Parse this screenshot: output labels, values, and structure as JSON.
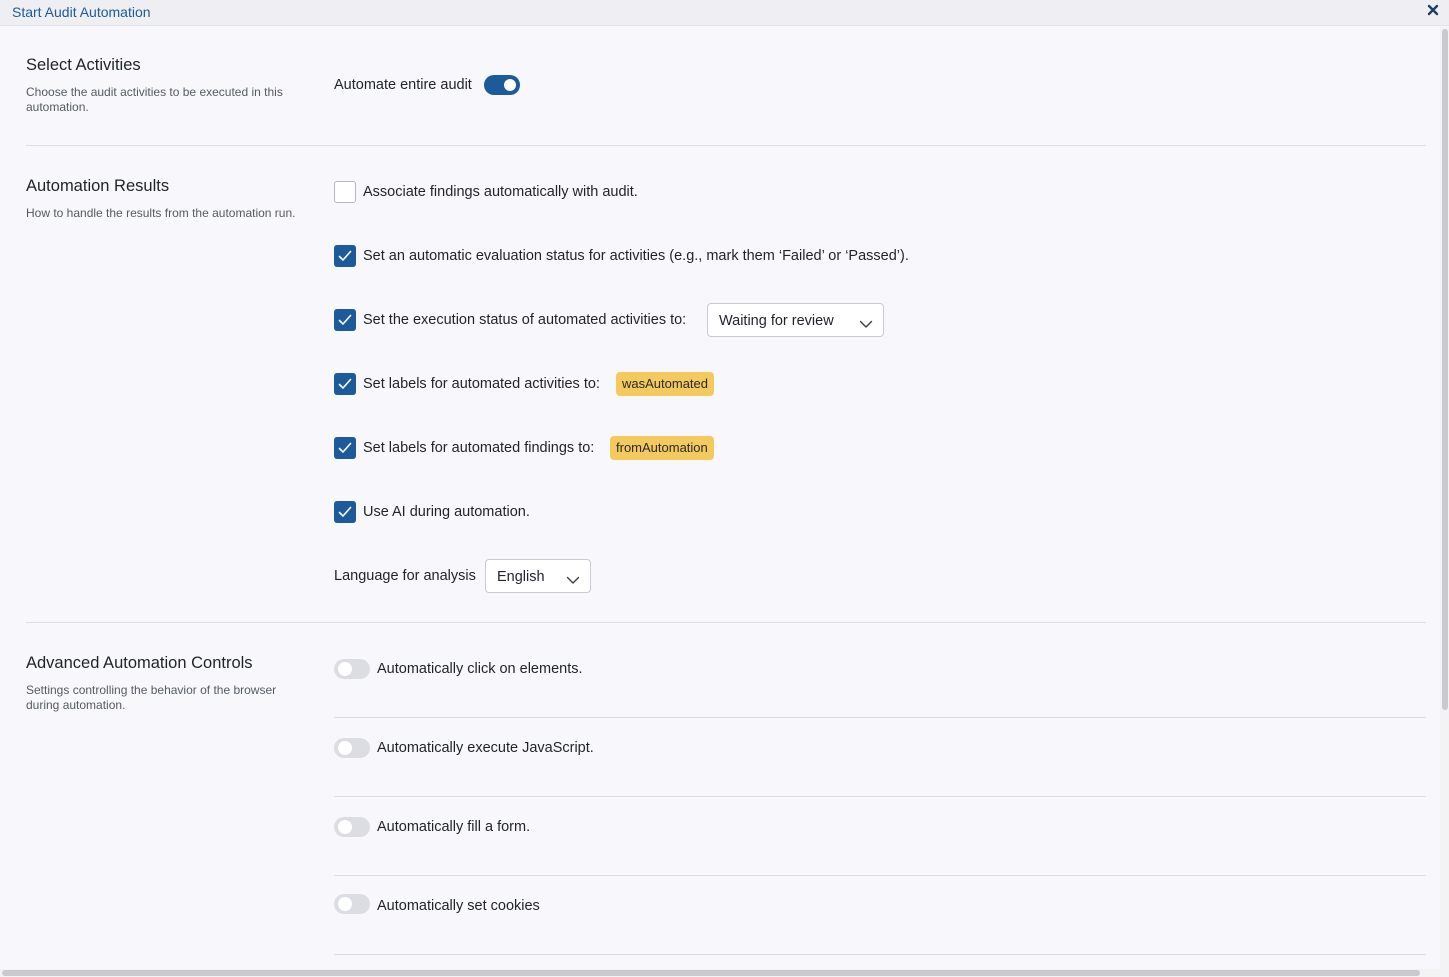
{
  "window": {
    "title": "Start Audit Automation"
  },
  "sections": {
    "select_activities": {
      "title": "Select Activities",
      "description": "Choose the audit activities to be executed in this automation.",
      "toggle_label": "Automate entire audit",
      "toggle_on": true
    },
    "automation_results": {
      "title": "Automation Results",
      "description": "How to handle the results from the automation run.",
      "associate_findings": {
        "label": "Associate findings automatically with audit.",
        "checked": false
      },
      "evaluation_status": {
        "label": "Set an automatic evaluation status for activities (e.g., mark them ‘Failed’ or ‘Passed’).",
        "checked": true
      },
      "execution_status": {
        "label": "Set the execution status of automated activities to:",
        "checked": true,
        "selected": "Waiting for review"
      },
      "activity_labels": {
        "label": "Set labels for automated activities to:",
        "checked": true,
        "tag": "wasAutomated"
      },
      "finding_labels": {
        "label": "Set labels for automated findings to:",
        "checked": true,
        "tag": "fromAutomation"
      },
      "use_ai": {
        "label": "Use AI during automation.",
        "checked": true
      },
      "language": {
        "label": "Language for analysis",
        "selected": "English"
      }
    },
    "advanced_controls": {
      "title": "Advanced Automation Controls",
      "description": "Settings controlling the behavior of the browser during automation.",
      "items": [
        {
          "label": "Automatically click on elements.",
          "on": false
        },
        {
          "label": "Automatically execute JavaScript.",
          "on": false
        },
        {
          "label": "Automatically fill a form.",
          "on": false
        },
        {
          "label": "Automatically set cookies",
          "on": false
        }
      ]
    }
  },
  "colors": {
    "accent": "#1c5a9a",
    "title_text": "#1d5c94",
    "tag_background": "#f4c95d",
    "toggle_off": "#dcdde3"
  }
}
